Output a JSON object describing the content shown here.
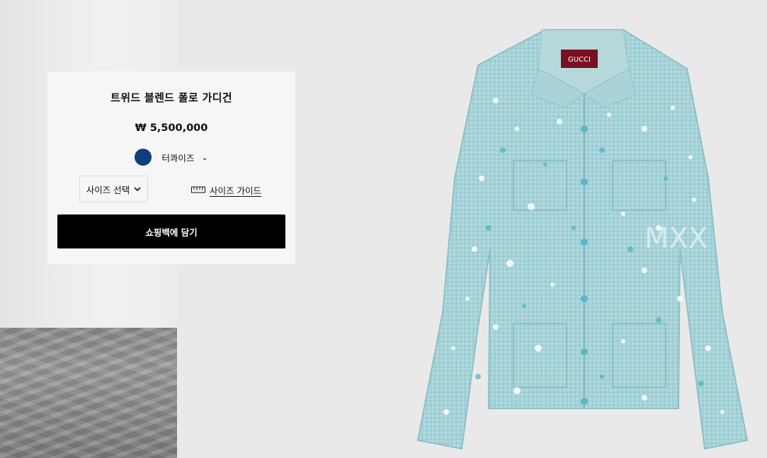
{
  "product": {
    "title": "트위드 블렌드 폴로 가디건",
    "price": "₩ 5,500,000",
    "color": {
      "label": "터콰이즈",
      "swatch_hex": "#0e3e7c",
      "icon": "chevron-down-icon"
    },
    "size_select": {
      "label": "사이즈 선택",
      "icon": "chevron-down-icon"
    },
    "size_guide": {
      "label": "사이즈 가이드",
      "icon": "ruler-icon"
    },
    "add_to_bag": "쇼핑백에 담기",
    "image": {
      "brand_tag": "GUCCI",
      "watermark": "MXX",
      "garment_color": "#9fd1d6"
    }
  }
}
